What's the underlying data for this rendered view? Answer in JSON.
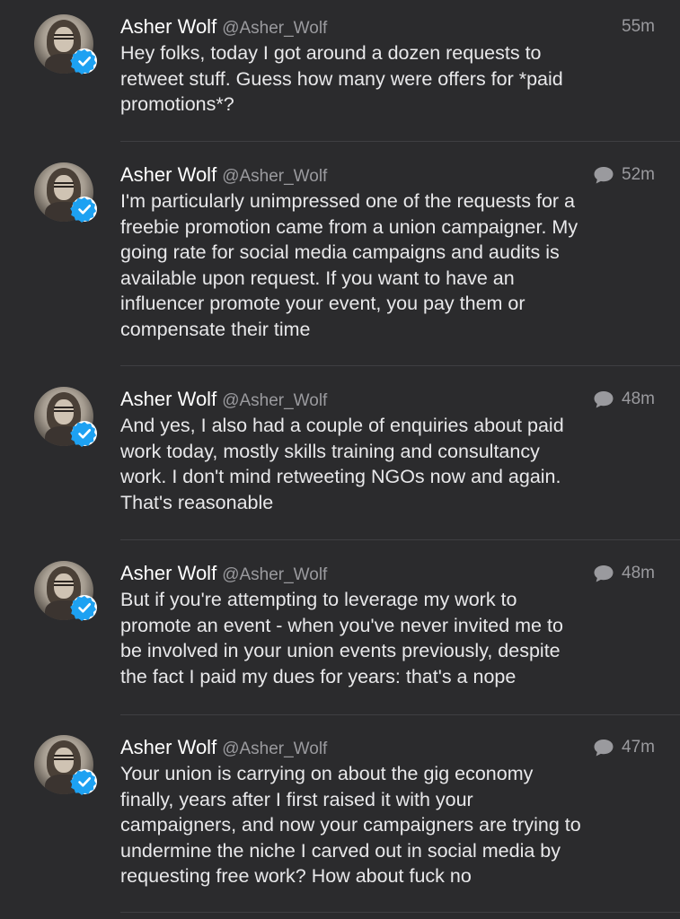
{
  "author": {
    "name": "Asher Wolf",
    "handle": "@Asher_Wolf",
    "avatar_icon": "avatar-photo",
    "verified_icon": "verified-badge-icon",
    "verified_color": "#1da1f2"
  },
  "tweets": [
    {
      "time": "55m",
      "has_reply_icon": false,
      "text": "Hey folks, today I got around a dozen requests to\nretweet stuff. Guess how many were offers for *paid\npromotions*?"
    },
    {
      "time": "52m",
      "has_reply_icon": true,
      "text": "I'm particularly unimpressed one of the requests for a\nfreebie promotion came from a union campaigner. My\ngoing rate for social media campaigns and audits is\navailable upon request. If you want to have an\ninfluencer promote your event, you pay them or\ncompensate their time"
    },
    {
      "time": "48m",
      "has_reply_icon": true,
      "text": "And yes, I also had a couple of enquiries about paid\nwork today, mostly skills training and consultancy\nwork. I don't mind retweeting NGOs now and again.\nThat's reasonable"
    },
    {
      "time": "48m",
      "has_reply_icon": true,
      "text": "But if you're attempting to leverage my work to\npromote an event - when you've never invited me to\nbe involved in your union events previously, despite\nthe fact I paid my dues for years: that's a nope"
    },
    {
      "time": "47m",
      "has_reply_icon": true,
      "text": "Your union is carrying on about the gig economy\nfinally, years after I first raised it with your\ncampaigners, and now your campaigners are trying to\nundermine the niche I carved out in social media by\nrequesting free work? How about fuck no"
    }
  ],
  "colors": {
    "background": "#2b2b2d",
    "text": "#e8e8ea",
    "secondary": "#9a9a9e",
    "divider": "#3f3f42"
  }
}
